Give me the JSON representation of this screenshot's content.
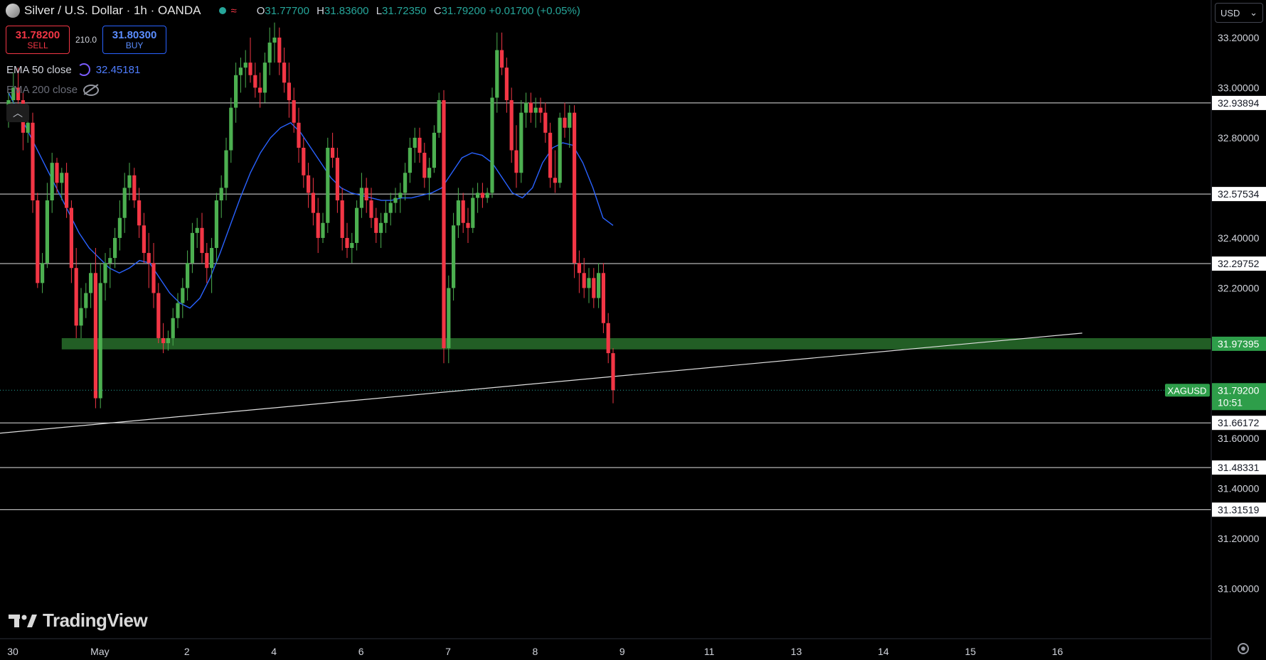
{
  "header": {
    "title": "Silver / U.S. Dollar · 1h · OANDA",
    "open_key": "O",
    "open": "31.77700",
    "high_key": "H",
    "high": "31.83600",
    "low_key": "L",
    "low": "31.72350",
    "close_key": "C",
    "close": "31.79200",
    "change": "+0.01700 (+0.05%)"
  },
  "trade": {
    "sell_price": "31.78200",
    "sell_label": "SELL",
    "spread": "210.0",
    "buy_price": "31.80300",
    "buy_label": "BUY"
  },
  "indicators": {
    "ema50_label": "EMA 50 close",
    "ema50_value": "32.45181",
    "ema200_label": "EMA 200 close"
  },
  "currency": "USD",
  "branding": {
    "logo_text": "TradingView"
  },
  "colors": {
    "up": "#26a69a",
    "candle_up": "#4caf50",
    "candle_down": "#f23645",
    "ema50": "#2962ff",
    "support_zone": "#2e7d32",
    "bg": "#000000"
  },
  "chart_data": {
    "type": "candlestick",
    "symbol": "XAGUSD",
    "timeframe": "1h",
    "ylim": [
      30.8,
      33.35
    ],
    "y_ticks": [
      "33.20000",
      "33.00000",
      "32.80000",
      "32.40000",
      "32.20000",
      "31.60000",
      "31.40000",
      "31.20000",
      "31.00000"
    ],
    "x_ticks": [
      "30",
      "May",
      "2",
      "4",
      "6",
      "7",
      "8",
      "9",
      "11",
      "13",
      "14",
      "15",
      "16"
    ],
    "x_tick_index": [
      0,
      18,
      36,
      54,
      72,
      90,
      108,
      126,
      144,
      162,
      180,
      198,
      216
    ],
    "horizontal_levels": [
      "32.93894",
      "32.57534",
      "32.29752",
      "31.66172",
      "31.48331",
      "31.31519"
    ],
    "support_zone": {
      "label": "31.97395",
      "low": 31.955,
      "high": 32.0
    },
    "last_price": {
      "symbol": "XAGUSD",
      "price": "31.79200",
      "countdown": "10:51"
    },
    "trendline": {
      "from": {
        "index": -2,
        "price": 31.62
      },
      "to": {
        "index": 222,
        "price": 32.02
      }
    },
    "candles": [
      [
        32.88,
        32.98,
        32.84,
        32.95
      ],
      [
        32.95,
        33.06,
        32.9,
        33.0
      ],
      [
        33.0,
        33.08,
        32.92,
        32.95
      ],
      [
        32.95,
        32.98,
        32.75,
        32.82
      ],
      [
        32.82,
        32.92,
        32.78,
        32.86
      ],
      [
        32.86,
        32.9,
        32.5,
        32.55
      ],
      [
        32.55,
        32.58,
        32.2,
        32.22
      ],
      [
        32.22,
        32.34,
        32.18,
        32.3
      ],
      [
        32.3,
        32.62,
        32.28,
        32.55
      ],
      [
        32.55,
        32.74,
        32.5,
        32.7
      ],
      [
        32.7,
        32.72,
        32.58,
        32.62
      ],
      [
        32.62,
        32.68,
        32.55,
        32.66
      ],
      [
        32.66,
        32.7,
        32.48,
        32.52
      ],
      [
        32.52,
        32.55,
        32.22,
        32.28
      ],
      [
        32.28,
        32.36,
        32.0,
        32.05
      ],
      [
        32.05,
        32.2,
        32.0,
        32.12
      ],
      [
        32.12,
        32.22,
        32.08,
        32.18
      ],
      [
        32.18,
        32.3,
        32.12,
        32.26
      ],
      [
        32.26,
        32.36,
        31.72,
        31.76
      ],
      [
        31.76,
        32.3,
        31.72,
        32.22
      ],
      [
        32.22,
        32.34,
        32.15,
        32.3
      ],
      [
        32.3,
        32.36,
        32.2,
        32.32
      ],
      [
        32.32,
        32.44,
        32.28,
        32.4
      ],
      [
        32.4,
        32.55,
        32.35,
        32.48
      ],
      [
        32.48,
        32.66,
        32.42,
        32.6
      ],
      [
        32.6,
        32.7,
        32.55,
        32.65
      ],
      [
        32.65,
        32.68,
        32.52,
        32.55
      ],
      [
        32.55,
        32.6,
        32.4,
        32.45
      ],
      [
        32.45,
        32.5,
        32.3,
        32.34
      ],
      [
        32.34,
        32.42,
        32.2,
        32.3
      ],
      [
        32.3,
        32.38,
        32.12,
        32.18
      ],
      [
        32.18,
        32.22,
        31.98,
        32.0
      ],
      [
        32.0,
        32.06,
        31.94,
        31.98
      ],
      [
        31.98,
        32.03,
        31.95,
        32.0
      ],
      [
        32.0,
        32.12,
        31.97,
        32.08
      ],
      [
        32.08,
        32.18,
        32.04,
        32.14
      ],
      [
        32.14,
        32.24,
        32.08,
        32.2
      ],
      [
        32.2,
        32.35,
        32.15,
        32.3
      ],
      [
        32.3,
        32.46,
        32.26,
        32.42
      ],
      [
        32.42,
        32.48,
        32.36,
        32.44
      ],
      [
        32.44,
        32.5,
        32.3,
        32.34
      ],
      [
        32.34,
        32.38,
        32.22,
        32.28
      ],
      [
        32.28,
        32.4,
        32.18,
        32.36
      ],
      [
        32.36,
        32.58,
        32.3,
        32.55
      ],
      [
        32.55,
        32.65,
        32.48,
        32.6
      ],
      [
        32.6,
        32.8,
        32.55,
        32.75
      ],
      [
        32.75,
        32.96,
        32.7,
        32.92
      ],
      [
        32.92,
        33.1,
        32.86,
        33.05
      ],
      [
        33.05,
        33.12,
        32.98,
        33.08
      ],
      [
        33.08,
        33.15,
        33.0,
        33.1
      ],
      [
        33.1,
        33.2,
        33.02,
        33.05
      ],
      [
        33.05,
        33.1,
        32.96,
        33.0
      ],
      [
        33.0,
        33.06,
        32.92,
        32.98
      ],
      [
        32.98,
        33.14,
        32.94,
        33.1
      ],
      [
        33.1,
        33.24,
        33.05,
        33.18
      ],
      [
        33.18,
        33.26,
        33.1,
        33.2
      ],
      [
        33.2,
        33.24,
        33.05,
        33.1
      ],
      [
        33.1,
        33.16,
        32.98,
        33.02
      ],
      [
        33.02,
        33.1,
        32.88,
        32.95
      ],
      [
        32.95,
        33.0,
        32.82,
        32.86
      ],
      [
        32.86,
        32.92,
        32.7,
        32.76
      ],
      [
        32.76,
        32.8,
        32.6,
        32.65
      ],
      [
        32.65,
        32.7,
        32.52,
        32.58
      ],
      [
        32.58,
        32.64,
        32.45,
        32.5
      ],
      [
        32.5,
        32.56,
        32.34,
        32.4
      ],
      [
        32.4,
        32.5,
        32.38,
        32.46
      ],
      [
        32.46,
        32.8,
        32.42,
        32.76
      ],
      [
        32.76,
        32.82,
        32.68,
        32.72
      ],
      [
        32.72,
        32.76,
        32.5,
        32.55
      ],
      [
        32.55,
        32.6,
        32.35,
        32.4
      ],
      [
        32.4,
        32.46,
        32.32,
        32.36
      ],
      [
        32.36,
        32.42,
        32.3,
        32.38
      ],
      [
        32.38,
        32.55,
        32.35,
        32.52
      ],
      [
        32.52,
        32.66,
        32.48,
        32.6
      ],
      [
        32.6,
        32.64,
        32.5,
        32.55
      ],
      [
        32.55,
        32.6,
        32.44,
        32.48
      ],
      [
        32.48,
        32.52,
        32.38,
        32.42
      ],
      [
        32.42,
        32.5,
        32.36,
        32.46
      ],
      [
        32.46,
        32.55,
        32.42,
        32.5
      ],
      [
        32.5,
        32.58,
        32.45,
        32.54
      ],
      [
        32.54,
        32.6,
        32.5,
        32.56
      ],
      [
        32.56,
        32.62,
        32.5,
        32.58
      ],
      [
        32.58,
        32.7,
        32.55,
        32.66
      ],
      [
        32.66,
        32.8,
        32.62,
        32.76
      ],
      [
        32.76,
        32.84,
        32.7,
        32.8
      ],
      [
        32.8,
        32.84,
        32.7,
        32.74
      ],
      [
        32.74,
        32.78,
        32.6,
        32.64
      ],
      [
        32.64,
        32.72,
        32.55,
        32.68
      ],
      [
        32.68,
        32.85,
        32.66,
        32.82
      ],
      [
        32.82,
        32.98,
        32.8,
        32.95
      ],
      [
        32.95,
        32.99,
        31.9,
        31.96
      ],
      [
        31.96,
        32.25,
        31.9,
        32.2
      ],
      [
        32.2,
        32.5,
        32.15,
        32.45
      ],
      [
        32.45,
        32.6,
        32.4,
        32.55
      ],
      [
        32.55,
        32.58,
        32.42,
        32.46
      ],
      [
        32.46,
        32.52,
        32.38,
        32.44
      ],
      [
        32.44,
        32.6,
        32.42,
        32.56
      ],
      [
        32.56,
        32.62,
        32.5,
        32.58
      ],
      [
        32.58,
        32.62,
        32.52,
        32.56
      ],
      [
        32.56,
        32.6,
        32.54,
        32.58
      ],
      [
        32.58,
        33.0,
        32.56,
        32.96
      ],
      [
        32.96,
        33.22,
        32.9,
        33.15
      ],
      [
        33.15,
        33.22,
        33.05,
        33.08
      ],
      [
        33.08,
        33.12,
        32.9,
        32.95
      ],
      [
        32.95,
        33.0,
        32.7,
        32.75
      ],
      [
        32.75,
        32.85,
        32.6,
        32.66
      ],
      [
        32.66,
        32.95,
        32.62,
        32.9
      ],
      [
        32.9,
        32.98,
        32.84,
        32.94
      ],
      [
        32.94,
        32.98,
        32.86,
        32.9
      ],
      [
        32.9,
        32.96,
        32.84,
        32.92
      ],
      [
        32.92,
        32.96,
        32.86,
        32.9
      ],
      [
        32.9,
        32.94,
        32.78,
        32.82
      ],
      [
        32.82,
        32.86,
        32.6,
        32.64
      ],
      [
        32.64,
        32.75,
        32.58,
        32.62
      ],
      [
        32.62,
        32.9,
        32.6,
        32.88
      ],
      [
        32.88,
        32.94,
        32.8,
        32.84
      ],
      [
        32.84,
        32.93,
        32.76,
        32.9
      ],
      [
        32.9,
        32.93,
        32.24,
        32.3
      ],
      [
        32.3,
        32.35,
        32.18,
        32.26
      ],
      [
        32.26,
        32.32,
        32.16,
        32.2
      ],
      [
        32.2,
        32.28,
        32.14,
        32.24
      ],
      [
        32.24,
        32.28,
        32.12,
        32.16
      ],
      [
        32.16,
        32.3,
        32.12,
        32.26
      ],
      [
        32.26,
        32.3,
        32.02,
        32.06
      ],
      [
        32.06,
        32.1,
        31.9,
        31.94
      ],
      [
        31.94,
        31.96,
        31.74,
        31.792
      ]
    ],
    "ema50": [
      32.98,
      32.9,
      32.82,
      32.74,
      32.66,
      32.58,
      32.5,
      32.42,
      32.36,
      32.32,
      32.28,
      32.26,
      32.28,
      32.31,
      32.3,
      32.24,
      32.18,
      32.14,
      32.12,
      32.16,
      32.24,
      32.34,
      32.45,
      32.56,
      32.66,
      32.74,
      32.8,
      32.84,
      32.86,
      32.82,
      32.76,
      32.7,
      32.64,
      32.6,
      32.58,
      32.57,
      32.56,
      32.55,
      32.55,
      32.56,
      32.56,
      32.57,
      32.58,
      32.6,
      32.66,
      32.72,
      32.74,
      32.73,
      32.7,
      32.64,
      32.58,
      32.56,
      32.6,
      32.7,
      32.76,
      32.78,
      32.77,
      32.7,
      32.6,
      32.48,
      32.45
    ]
  }
}
